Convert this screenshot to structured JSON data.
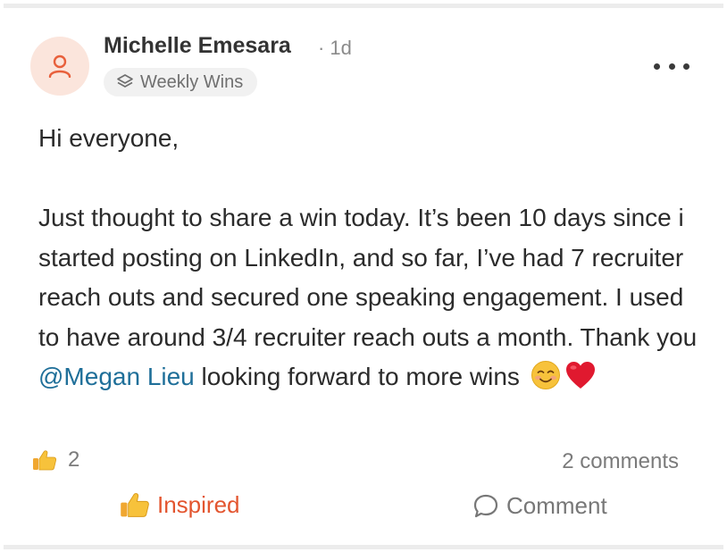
{
  "post": {
    "author": "Michelle Emesara",
    "dot": "·",
    "time": "1d",
    "group": "Weekly Wins",
    "greeting": "Hi everyone,",
    "body_main": "Just thought to share a win today. It’s been 10 days since i started posting on LinkedIn, and so far, I’ve had 7 recruiter reach outs and secured one speaking engagement. I used to have around 3/4 recruiter reach outs a month. Thank you ",
    "mention": "@Megan Lieu",
    "body_end": " looking forward to more wins",
    "reaction_count": "2",
    "comments_count": "2 comments"
  },
  "actions": {
    "inspired_label": "Inspired",
    "comment_label": "Comment"
  },
  "icons": {
    "avatar": "user-icon",
    "group": "layers-icon",
    "more": "more-dots-icon",
    "reaction": "thumbs-up-icon",
    "emoji_smile": "smiling-face-icon",
    "emoji_heart": "red-heart-icon",
    "comment": "speech-bubble-icon"
  },
  "colors": {
    "accent": "#e3552f",
    "avatar_bg": "#fbe5dc",
    "mention": "#1f6f99",
    "muted": "#7b7b7b"
  }
}
